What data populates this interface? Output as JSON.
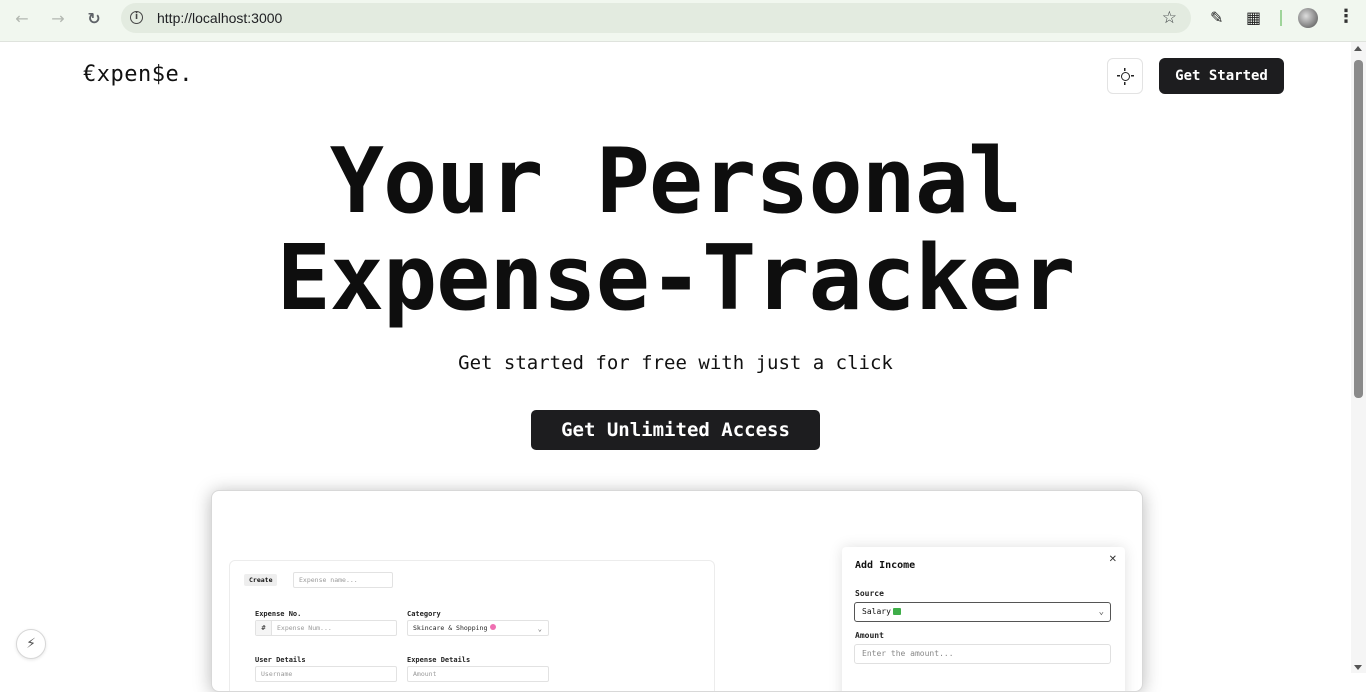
{
  "browser": {
    "url": "http://localhost:3000",
    "icons": {
      "back": "back-arrow-icon",
      "forward": "forward-arrow-icon",
      "reload": "reload-icon",
      "info": "site-info-icon",
      "bookmark": "star-icon",
      "extension1": "eyedropper-icon",
      "extensions": "puzzle-icon",
      "profile": "avatar",
      "menu": "more-vert-icon"
    }
  },
  "header": {
    "logo": "€xpen$e.",
    "theme_toggle_icon": "sun-icon",
    "get_started_label": "Get Started"
  },
  "hero": {
    "title_line1": "Your Personal",
    "title_line2": "Expense-Tracker",
    "subtitle": "Get started for free with just a click",
    "cta_label": "Get Unlimited Access"
  },
  "preview": {
    "expense_form": {
      "create_label": "Create",
      "expense_name_placeholder": "Expense name...",
      "expense_no_label": "Expense No.",
      "expense_no_prefix": "#",
      "expense_no_placeholder": "Expense Num...",
      "category_label": "Category",
      "category_value": "Skincare & Shopping",
      "user_details_label": "User Details",
      "user_details_placeholder": "Username",
      "expense_details_label": "Expense Details",
      "expense_details_placeholder": "Amount"
    },
    "income_form": {
      "title": "Add Income",
      "source_label": "Source",
      "source_value": "Salary",
      "amount_label": "Amount",
      "amount_placeholder": "Enter the amount..."
    }
  },
  "colors": {
    "dark_button": "#1d1d1f",
    "chrome_bg": "#f1f7ef"
  },
  "devtools_icon": "lightning-bolt-icon"
}
